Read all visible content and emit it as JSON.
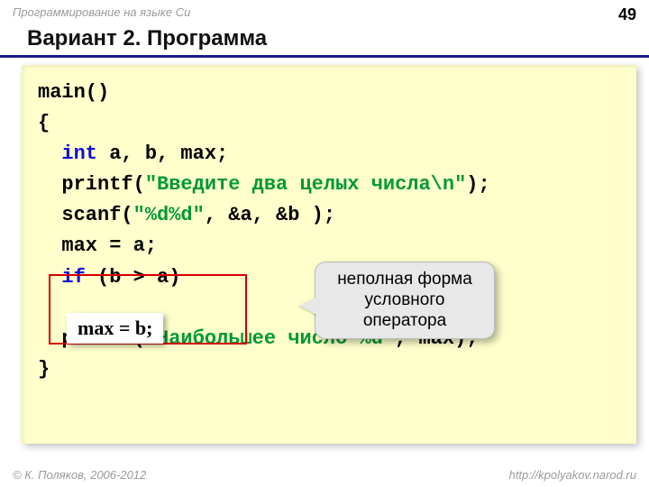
{
  "header": {
    "course": "Программирование на языке Си",
    "page_number": "49"
  },
  "title": "Вариант 2. Программа",
  "code": {
    "l1": "main()",
    "l2": "{",
    "l3a": "  ",
    "l3_type": "int",
    "l3b": " a, b, max;",
    "l4a": "  printf(",
    "l4_str": "\"Введите два целых числа\\n\"",
    "l4b": ");",
    "l5a": "  scanf(",
    "l5_str": "\"%d%d\"",
    "l5b": ", &a, &b );",
    "l6": "  max = a;",
    "l7a": "  ",
    "l7_if": "if",
    "l7b": " (b > a)",
    "l8_blank": " ",
    "l9a": "  printf(",
    "l9_str": "\"Наибольшее число %d\"",
    "l9b": ", max);",
    "l10": "}"
  },
  "assign_chip": "max = b;",
  "callout": "неполная форма условного оператора",
  "footer": {
    "left": "© К. Поляков, 2006-2012",
    "right": "http://kpolyakov.narod.ru"
  }
}
